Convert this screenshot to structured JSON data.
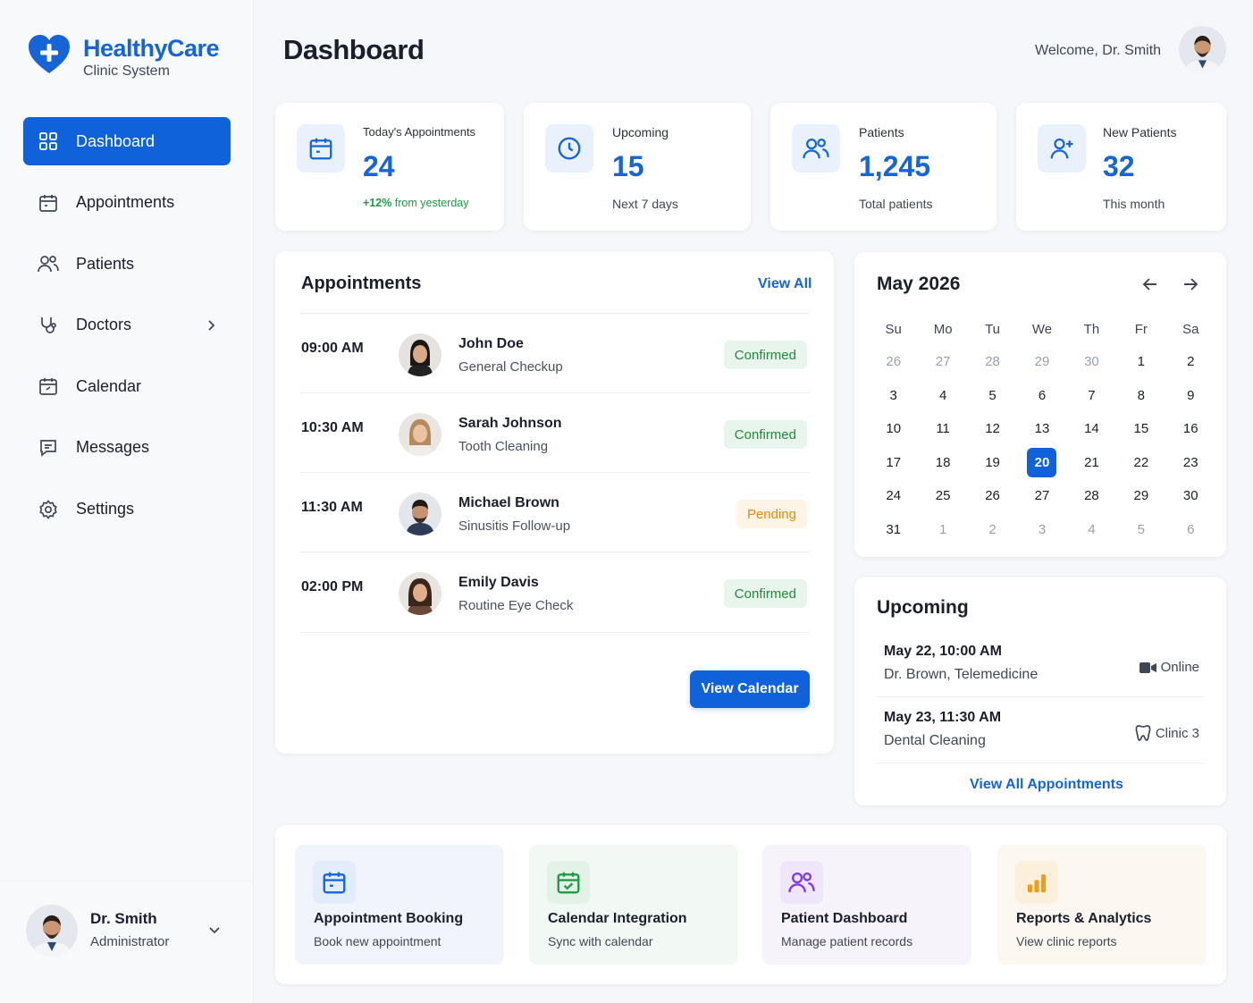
{
  "brand": {
    "title": "HealthyCare",
    "subtitle": "Clinic System"
  },
  "sidebar": {
    "items": [
      {
        "label": "Dashboard",
        "icon": "grid-icon",
        "active": true
      },
      {
        "label": "Appointments",
        "icon": "calendar-icon"
      },
      {
        "label": "Patients",
        "icon": "users-icon"
      },
      {
        "label": "Doctors",
        "icon": "stethoscope-icon",
        "has_submenu": true
      },
      {
        "label": "Calendar",
        "icon": "calendar-edit-icon"
      },
      {
        "label": "Messages",
        "icon": "message-icon"
      },
      {
        "label": "Settings",
        "icon": "gear-icon"
      }
    ],
    "profile": {
      "name": "Dr. Smith",
      "role": "Administrator"
    }
  },
  "header": {
    "title": "Dashboard",
    "welcome": "Welcome, Dr. Smith"
  },
  "stats": [
    {
      "label": "Today's Appointments",
      "value": "24",
      "foot_highlight": "+12%",
      "foot": " from yesterday",
      "icon": "calendar-icon"
    },
    {
      "label": "Upcoming",
      "value": "15",
      "foot": "Next 7 days",
      "icon": "clock-icon"
    },
    {
      "label": "Patients",
      "value": "1,245",
      "foot": "Total patients",
      "icon": "users-icon"
    },
    {
      "label": "New Patients",
      "value": "32",
      "foot": "This month",
      "icon": "user-plus-icon"
    }
  ],
  "appointments": {
    "title": "Appointments",
    "view_all": "View All",
    "button": "View Calendar",
    "rows": [
      {
        "time": "09:00 AM",
        "name": "John Doe",
        "desc": "General Checkup",
        "status": "Confirmed",
        "status_type": "confirmed"
      },
      {
        "time": "10:30 AM",
        "name": "Sarah Johnson",
        "desc": "Tooth Cleaning",
        "status": "Confirmed",
        "status_type": "confirmed"
      },
      {
        "time": "11:30 AM",
        "name": "Michael Brown",
        "desc": "Sinusitis Follow-up",
        "status": "Pending",
        "status_type": "pending"
      },
      {
        "time": "02:00 PM",
        "name": "Emily Davis",
        "desc": "Routine Eye Check",
        "status": "Confirmed",
        "status_type": "confirmed"
      }
    ]
  },
  "calendar": {
    "title": "May 2026",
    "weekdays": [
      "Su",
      "Mo",
      "Tu",
      "We",
      "Th",
      "Fr",
      "Sa"
    ],
    "days": [
      [
        "26",
        "m"
      ],
      [
        "27",
        "m"
      ],
      [
        "28",
        "m"
      ],
      [
        "29",
        "m"
      ],
      [
        "30",
        "m"
      ],
      [
        "1",
        ""
      ],
      [
        "2",
        ""
      ],
      [
        "3",
        ""
      ],
      [
        "4",
        ""
      ],
      [
        "5",
        ""
      ],
      [
        "6",
        ""
      ],
      [
        "7",
        ""
      ],
      [
        "8",
        ""
      ],
      [
        "9",
        ""
      ],
      [
        "10",
        ""
      ],
      [
        "11",
        ""
      ],
      [
        "12",
        ""
      ],
      [
        "13",
        ""
      ],
      [
        "14",
        ""
      ],
      [
        "15",
        ""
      ],
      [
        "16",
        ""
      ],
      [
        "17",
        ""
      ],
      [
        "18",
        ""
      ],
      [
        "19",
        ""
      ],
      [
        "20",
        "t"
      ],
      [
        "21",
        ""
      ],
      [
        "22",
        ""
      ],
      [
        "23",
        ""
      ],
      [
        "24",
        ""
      ],
      [
        "25",
        ""
      ],
      [
        "26",
        ""
      ],
      [
        "27",
        ""
      ],
      [
        "28",
        ""
      ],
      [
        "29",
        ""
      ],
      [
        "30",
        ""
      ],
      [
        "31",
        ""
      ],
      [
        "1",
        "m"
      ],
      [
        "2",
        "m"
      ],
      [
        "3",
        "m"
      ],
      [
        "4",
        "m"
      ],
      [
        "5",
        "m"
      ],
      [
        "6",
        "m"
      ]
    ]
  },
  "upcoming": {
    "title": "Upcoming",
    "items": [
      {
        "date": "May 22, 10:00 AM",
        "desc": "Dr. Brown, Telemedicine",
        "tag": "Online",
        "tag_icon": "video-icon"
      },
      {
        "date": "May 23, 11:30 AM",
        "desc": "Dental Cleaning",
        "tag": "Clinic 3",
        "tag_icon": "tooth-icon"
      }
    ],
    "view_all": "View All Appointments"
  },
  "tiles": [
    {
      "title": "Appointment Booking",
      "sub": "Book new appointment",
      "icon": "calendar-icon",
      "color": "#1565d8",
      "bg": "#f1f5fb"
    },
    {
      "title": "Calendar Integration",
      "sub": "Sync with calendar",
      "icon": "calendar-check-icon",
      "color": "#1f9a46",
      "bg": "#f2f8f4"
    },
    {
      "title": "Patient Dashboard",
      "sub": "Manage patient records",
      "icon": "users-icon",
      "color": "#7c3aed",
      "bg": "#f6f3fb"
    },
    {
      "title": "Reports & Analytics",
      "sub": "View clinic reports",
      "icon": "bar-chart-icon",
      "color": "#f39c12",
      "bg": "#fcf7f0"
    }
  ]
}
